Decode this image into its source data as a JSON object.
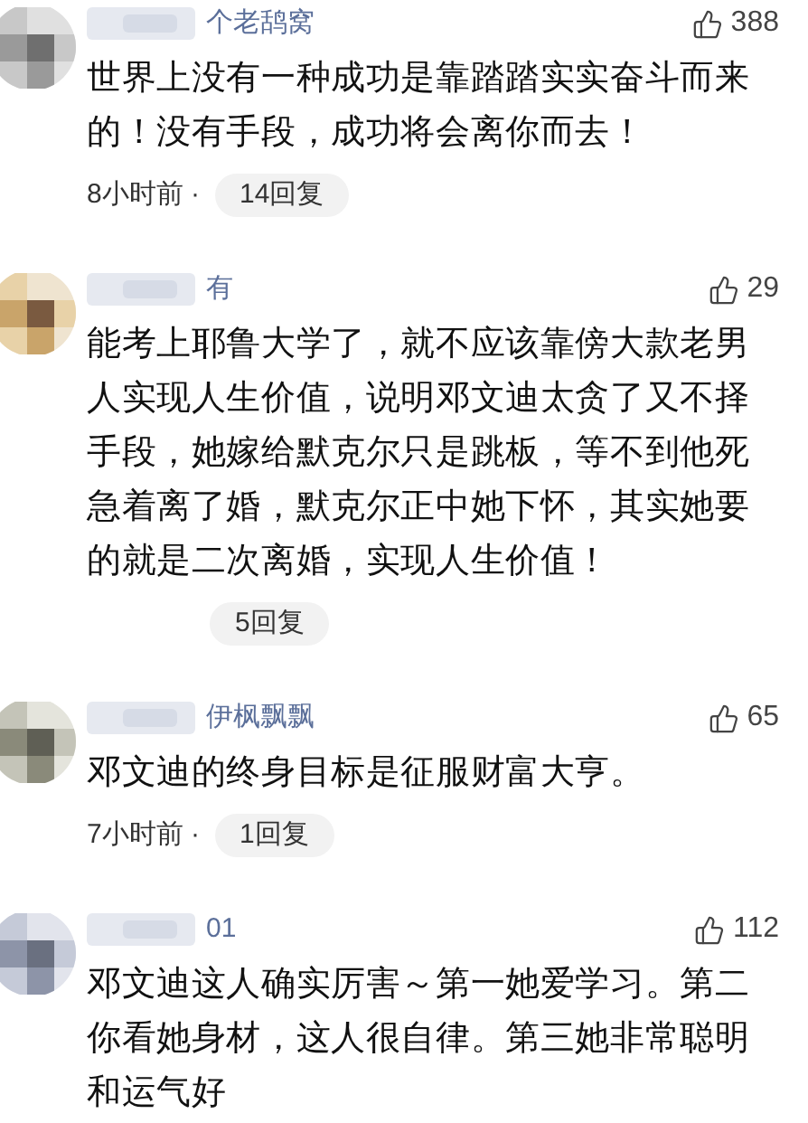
{
  "comments": [
    {
      "username": "个老鸹窝",
      "likes": "388",
      "text": "世界上没有一种成功是靠踏踏实实奋斗而来的！没有手段，成功将会离你而去！",
      "time": "8小时前 ·",
      "replies": "14回复"
    },
    {
      "username": "有",
      "likes": "29",
      "text": "能考上耶鲁大学了，就不应该靠傍大款老男人实现人生价值，说明邓文迪太贪了又不择手段，她嫁给默克尔只是跳板，等不到他死急着离了婚，默克尔正中她下怀，其实她要的就是二次离婚，实现人生价值！",
      "replies": "5回复"
    },
    {
      "username": "伊枫飘飘",
      "likes": "65",
      "text": "邓文迪的终身目标是征服财富大亨。",
      "time": "7小时前 ·",
      "replies": "1回复"
    },
    {
      "username": "01",
      "likes": "112",
      "text": "邓文迪这人确实厉害～第一她爱学习。第二你看她身材，这人很自律。第三她非常聪明和运气好"
    }
  ]
}
